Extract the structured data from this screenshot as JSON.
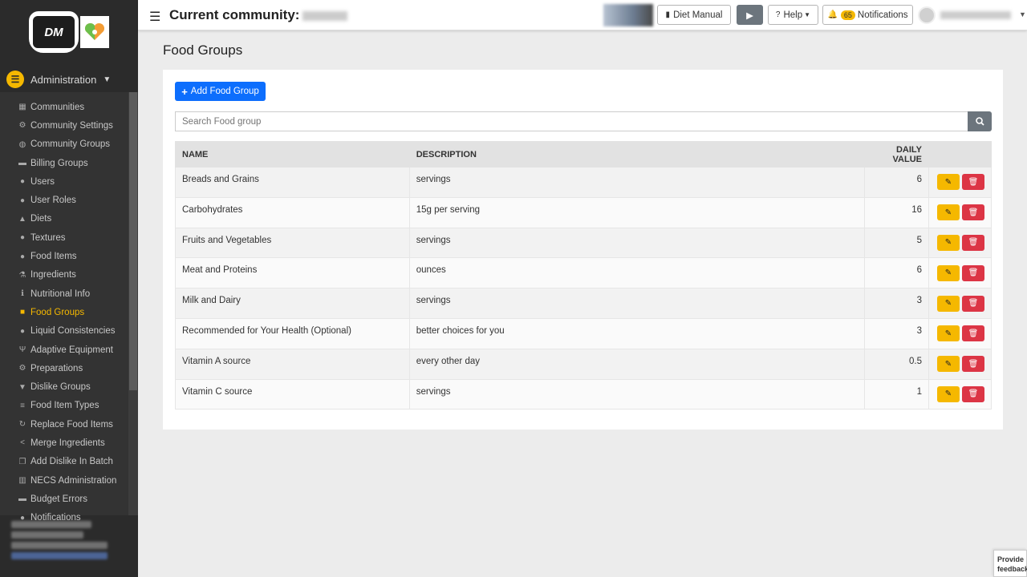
{
  "topbar": {
    "community_label": "Current community:",
    "diet_manual": "Diet Manual",
    "help": "Help",
    "notifications_count": "65",
    "notifications_label": "Notifications"
  },
  "sidebar": {
    "logo_text": "DM",
    "admin_label": "Administration",
    "items": [
      {
        "label": "Communities",
        "icon": "building-icon"
      },
      {
        "label": "Community Settings",
        "icon": "gear-icon"
      },
      {
        "label": "Community Groups",
        "icon": "globe-icon"
      },
      {
        "label": "Billing Groups",
        "icon": "money-icon"
      },
      {
        "label": "Users",
        "icon": "users-icon"
      },
      {
        "label": "User Roles",
        "icon": "user-lock-icon"
      },
      {
        "label": "Diets",
        "icon": "warning-icon"
      },
      {
        "label": "Textures",
        "icon": "tint-icon"
      },
      {
        "label": "Food Items",
        "icon": "apple-icon"
      },
      {
        "label": "Ingredients",
        "icon": "flask-icon"
      },
      {
        "label": "Nutritional Info",
        "icon": "info-icon"
      },
      {
        "label": "Food Groups",
        "icon": "cubes-icon",
        "active": true
      },
      {
        "label": "Liquid Consistencies",
        "icon": "tint-icon"
      },
      {
        "label": "Adaptive Equipment",
        "icon": "utensils-icon"
      },
      {
        "label": "Preparations",
        "icon": "cogs-icon"
      },
      {
        "label": "Dislike Groups",
        "icon": "thumbs-down-icon"
      },
      {
        "label": "Food Item Types",
        "icon": "list-icon"
      },
      {
        "label": "Replace Food Items",
        "icon": "refresh-icon"
      },
      {
        "label": "Merge Ingredients",
        "icon": "share-icon"
      },
      {
        "label": "Add Dislike In Batch",
        "icon": "copy-icon"
      },
      {
        "label": "NECS Administration",
        "icon": "bank-icon"
      },
      {
        "label": "Budget Errors",
        "icon": "money-icon"
      },
      {
        "label": "Notifications",
        "icon": "bell-icon"
      }
    ]
  },
  "main": {
    "page_title": "Food Groups",
    "add_button": "Add Food Group",
    "search_placeholder": "Search Food group",
    "columns": [
      "NAME",
      "DESCRIPTION",
      "DAILY VALUE"
    ],
    "rows": [
      {
        "name": "Breads and Grains",
        "description": "servings",
        "daily_value": "6"
      },
      {
        "name": "Carbohydrates",
        "description": "15g per serving",
        "daily_value": "16"
      },
      {
        "name": "Fruits and Vegetables",
        "description": "servings",
        "daily_value": "5"
      },
      {
        "name": "Meat and Proteins",
        "description": "ounces",
        "daily_value": "6"
      },
      {
        "name": "Milk and Dairy",
        "description": "servings",
        "daily_value": "3"
      },
      {
        "name": "Recommended for Your Health (Optional)",
        "description": "better choices for you",
        "daily_value": "3"
      },
      {
        "name": "Vitamin A source",
        "description": "every other day",
        "daily_value": "0.5"
      },
      {
        "name": "Vitamin C source",
        "description": "servings",
        "daily_value": "1"
      }
    ]
  },
  "feedback": {
    "label": "Provide feedback"
  },
  "colors": {
    "accent": "#f5b800",
    "primary": "#0d6efd",
    "danger": "#dc3545",
    "sidebar": "#2b2b2b"
  }
}
